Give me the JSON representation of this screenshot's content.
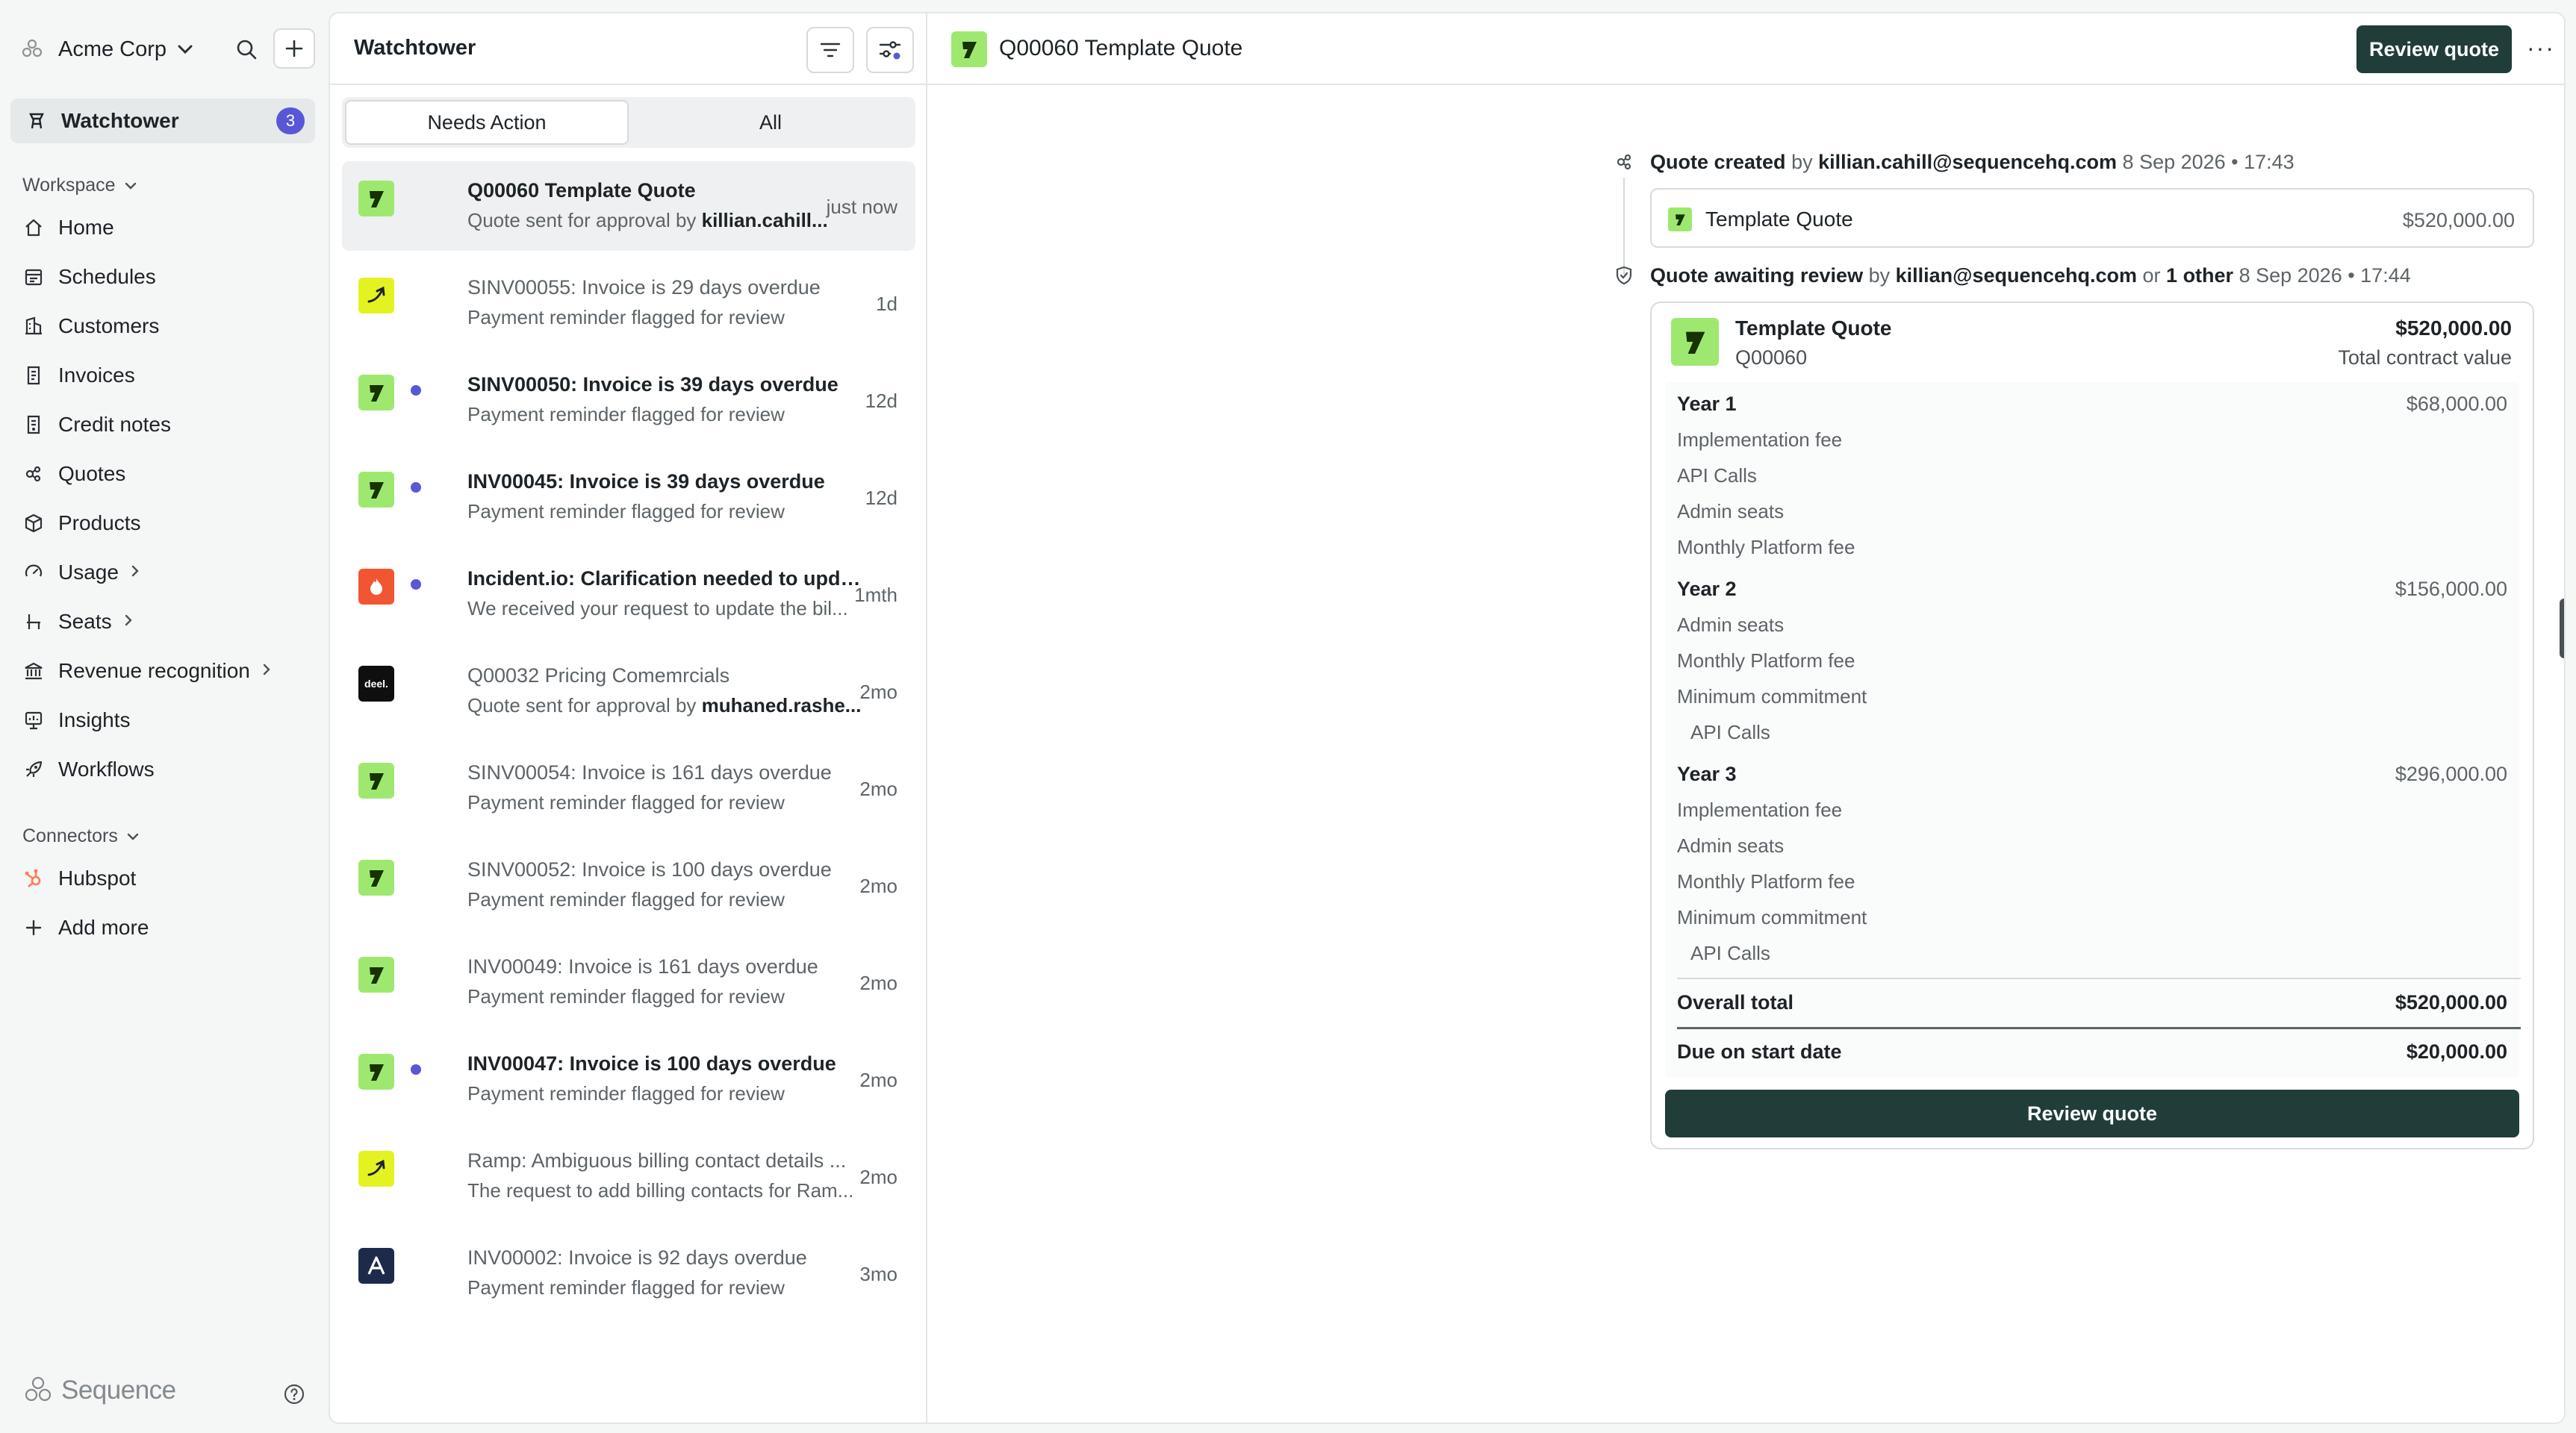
{
  "org": {
    "name": "Acme Corp"
  },
  "nav": {
    "active": {
      "label": "Watchtower",
      "badge": "3"
    },
    "workspace_label": "Workspace",
    "items": [
      {
        "label": "Home",
        "icon": "home-icon"
      },
      {
        "label": "Schedules",
        "icon": "schedule-icon"
      },
      {
        "label": "Customers",
        "icon": "building-icon"
      },
      {
        "label": "Invoices",
        "icon": "invoice-icon"
      },
      {
        "label": "Credit notes",
        "icon": "credit-note-icon"
      },
      {
        "label": "Quotes",
        "icon": "quote-icon"
      },
      {
        "label": "Products",
        "icon": "box-icon"
      },
      {
        "label": "Usage",
        "icon": "gauge-icon"
      },
      {
        "label": "Seats",
        "icon": "seat-icon"
      },
      {
        "label": "Revenue recognition",
        "icon": "bank-icon"
      },
      {
        "label": "Insights",
        "icon": "chart-icon"
      },
      {
        "label": "Workflows",
        "icon": "rocket-icon"
      }
    ],
    "connectors_label": "Connectors",
    "connectors": [
      {
        "label": "Hubspot",
        "icon": "hubspot-icon"
      },
      {
        "label": "Add more",
        "icon": "plus-icon"
      }
    ],
    "brand": "Sequence"
  },
  "list": {
    "title": "Watchtower",
    "tabs": [
      "Needs Action",
      "All"
    ],
    "rows": [
      {
        "title": "Q00060 Template Quote",
        "sub_pre": "Quote sent for approval by ",
        "sub_bold": "killian.cahill...",
        "time": "just now",
        "logo": "wise",
        "unread": false,
        "bold": true,
        "selected": true
      },
      {
        "title": "SINV00055: Invoice is 29 days overdue",
        "sub_pre": "Payment reminder flagged for review",
        "sub_bold": "",
        "time": "1d",
        "logo": "ramp",
        "unread": false,
        "bold": false
      },
      {
        "title": "SINV00050: Invoice is 39 days overdue",
        "sub_pre": "Payment reminder flagged for review",
        "sub_bold": "",
        "time": "12d",
        "logo": "wise",
        "unread": true,
        "bold": true
      },
      {
        "title": "INV00045: Invoice is 39 days overdue",
        "sub_pre": "Payment reminder flagged for review",
        "sub_bold": "",
        "time": "12d",
        "logo": "wise",
        "unread": true,
        "bold": true
      },
      {
        "title": "Incident.io: Clarification needed to upda...",
        "sub_pre": "We received your request to update the bil...",
        "sub_bold": "",
        "time": "1mth",
        "logo": "incident",
        "unread": true,
        "bold": true
      },
      {
        "title": "Q00032 Pricing Comemrcials",
        "sub_pre": "Quote sent for approval by ",
        "sub_bold": "muhaned.rashe...",
        "time": "2mo",
        "logo": "deel",
        "unread": false,
        "bold": false
      },
      {
        "title": "SINV00054: Invoice is 161 days overdue",
        "sub_pre": "Payment reminder flagged for review",
        "sub_bold": "",
        "time": "2mo",
        "logo": "wise",
        "unread": false,
        "bold": false
      },
      {
        "title": "SINV00052: Invoice is 100 days overdue",
        "sub_pre": "Payment reminder flagged for review",
        "sub_bold": "",
        "time": "2mo",
        "logo": "wise",
        "unread": false,
        "bold": false
      },
      {
        "title": "INV00049: Invoice is 161 days overdue",
        "sub_pre": "Payment reminder flagged for review",
        "sub_bold": "",
        "time": "2mo",
        "logo": "wise",
        "unread": false,
        "bold": false
      },
      {
        "title": "INV00047: Invoice is 100 days overdue",
        "sub_pre": "Payment reminder flagged for review",
        "sub_bold": "",
        "time": "2mo",
        "logo": "wise",
        "unread": true,
        "bold": true
      },
      {
        "title": "Ramp: Ambiguous billing contact details ...",
        "sub_pre": "The request to add billing contacts for Ram...",
        "sub_bold": "",
        "time": "2mo",
        "logo": "ramp",
        "unread": false,
        "bold": false
      },
      {
        "title": "INV00002: Invoice is 92 days overdue",
        "sub_pre": "Payment reminder flagged for review",
        "sub_bold": "",
        "time": "3mo",
        "logo": "anthropic",
        "unread": false,
        "bold": false
      }
    ],
    "logo_text": {
      "wise": "7",
      "ramp": "⤻",
      "incident": "🔥",
      "deel": "deel.",
      "anthropic": "A"
    }
  },
  "detail": {
    "title": "Q00060 Template Quote",
    "review_btn": "Review quote",
    "more": "···",
    "event1": {
      "action": "Quote created",
      "by": " by ",
      "user": "killian.cahill@sequencehq.com",
      "time": " 8 Sep 2026 • 17:43"
    },
    "mini_card": {
      "name": "Template Quote",
      "amount": "$520,000.00"
    },
    "event2": {
      "action": "Quote awaiting review",
      "by": " by ",
      "user": "killian@sequencehq.com",
      "or": " or ",
      "other": "1 other",
      "time": " 8 Sep 2026 • 17:44"
    },
    "quote": {
      "name": "Template Quote",
      "number": "Q00060",
      "total": "$520,000.00",
      "total_label": "Total contract value",
      "years": [
        {
          "label": "Year 1",
          "amount": "$68,000.00",
          "items": [
            "Implementation fee",
            "API Calls",
            "Admin seats",
            "Monthly Platform fee"
          ]
        },
        {
          "label": "Year 2",
          "amount": "$156,000.00",
          "items": [
            "Admin seats",
            "Monthly Platform fee",
            "Minimum commitment",
            "API Calls"
          ]
        },
        {
          "label": "Year 3",
          "amount": "$296,000.00",
          "items": [
            "Implementation fee",
            "Admin seats",
            "Monthly Platform fee",
            "Minimum commitment",
            "API Calls"
          ]
        }
      ],
      "overall_label": "Overall total",
      "overall_value": "$520,000.00",
      "due_label": "Due on start date",
      "due_value": "$20,000.00",
      "button": "Review quote"
    }
  },
  "colors": {
    "accent": "#5a57d6",
    "primary_button": "#203d3a",
    "wise_green": "#9fe870",
    "ramp_yellow": "#e4f222"
  }
}
